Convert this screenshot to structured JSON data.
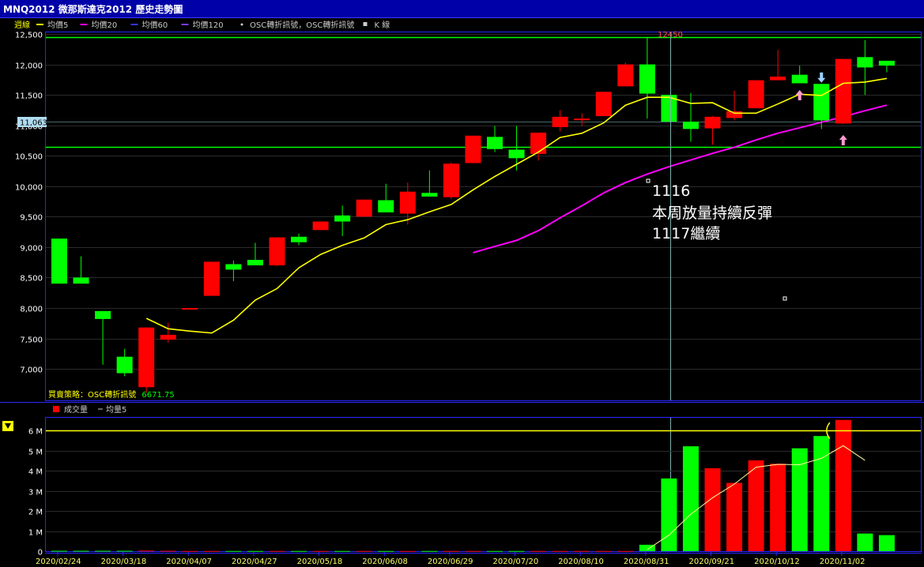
{
  "window_title": "MNQ2012 微那斯達克2012  歷史走勢圖",
  "colors": {
    "up": "#ff0000",
    "down": "#00ff00",
    "ma5": "#ffff00",
    "ma20": "#ff00ff",
    "ma60": "#3333ff",
    "ma120": "#7a3cff",
    "hline": "#00ff00",
    "vol_ref": "#ffff00",
    "frame": "#2828ff"
  },
  "legend": [
    {
      "label": "週線",
      "color": "#ffff00"
    },
    {
      "label": "均價5",
      "color": "#ffff00"
    },
    {
      "label": "均價20",
      "color": "#ff00ff"
    },
    {
      "label": "均價60",
      "color": "#3333ff"
    },
    {
      "label": "均價120",
      "color": "#7a3cff"
    },
    {
      "label": "OSC轉折訊號，OSC轉折訊號",
      "color": "#cccccc"
    },
    {
      "label": "K 線",
      "color": "#cccccc"
    }
  ],
  "vol_legend": {
    "vol_label": "成交量",
    "ma_label": "均量5"
  },
  "strategy_label": "買賣策略：OSC轉折訊號",
  "strategy_value": "6671.75",
  "cursor_value": "11,063",
  "high_marker": "12450",
  "annotation": [
    "1116",
    "本周放量持續反彈",
    "1117繼續"
  ],
  "chart_data": [
    {
      "type": "candlestick",
      "x_ticks": [
        "2020/02/24",
        "2020/03/18",
        "2020/04/07",
        "2020/04/27",
        "2020/05/18",
        "2020/06/08",
        "2020/06/29",
        "2020/07/20",
        "2020/08/10",
        "2020/08/31",
        "2020/09/21",
        "2020/10/12",
        "2020/11/02"
      ],
      "x_tick_index": [
        0,
        3,
        6,
        9,
        12,
        15,
        18,
        21,
        24,
        27,
        30,
        33,
        36
      ],
      "yticks": [
        "7,000",
        "7,500",
        "8,000",
        "8,500",
        "9,000",
        "9,500",
        "10,000",
        "10,500",
        "11,000",
        "11,500",
        "12,000",
        "12,500"
      ],
      "ylim": [
        6600,
        12500
      ],
      "candles": [
        {
          "o": 9140,
          "h": 9140,
          "l": 8400,
          "c": 8400
        },
        {
          "o": 8500,
          "h": 8850,
          "l": 8400,
          "c": 8400
        },
        {
          "o": 7950,
          "h": 7950,
          "l": 7070,
          "c": 7820
        },
        {
          "o": 7200,
          "h": 7330,
          "l": 6880,
          "c": 6930
        },
        {
          "o": 6700,
          "h": 7680,
          "l": 6610,
          "c": 7680
        },
        {
          "o": 7480,
          "h": 7760,
          "l": 7430,
          "c": 7560
        },
        {
          "o": 8000,
          "h": 8000,
          "l": 8000,
          "c": 8000
        },
        {
          "o": 8200,
          "h": 8760,
          "l": 8200,
          "c": 8760
        },
        {
          "o": 8720,
          "h": 8780,
          "l": 8440,
          "c": 8630
        },
        {
          "o": 8790,
          "h": 9070,
          "l": 8720,
          "c": 8700
        },
        {
          "o": 8700,
          "h": 9160,
          "l": 8690,
          "c": 9160
        },
        {
          "o": 9170,
          "h": 9220,
          "l": 9030,
          "c": 9080
        },
        {
          "o": 9280,
          "h": 9420,
          "l": 9280,
          "c": 9420
        },
        {
          "o": 9520,
          "h": 9680,
          "l": 9180,
          "c": 9420
        },
        {
          "o": 9500,
          "h": 9780,
          "l": 9500,
          "c": 9780
        },
        {
          "o": 9770,
          "h": 10040,
          "l": 9590,
          "c": 9570
        },
        {
          "o": 9550,
          "h": 10060,
          "l": 9370,
          "c": 9910
        },
        {
          "o": 9890,
          "h": 10260,
          "l": 9840,
          "c": 9830
        },
        {
          "o": 9820,
          "h": 10390,
          "l": 9790,
          "c": 10370
        },
        {
          "o": 10380,
          "h": 10830,
          "l": 10380,
          "c": 10830
        },
        {
          "o": 10810,
          "h": 10990,
          "l": 10560,
          "c": 10610
        },
        {
          "o": 10600,
          "h": 10990,
          "l": 10260,
          "c": 10460
        },
        {
          "o": 10530,
          "h": 10880,
          "l": 10420,
          "c": 10880
        },
        {
          "o": 10970,
          "h": 11250,
          "l": 10900,
          "c": 11140
        },
        {
          "o": 11110,
          "h": 11200,
          "l": 10990,
          "c": 11110
        },
        {
          "o": 11150,
          "h": 11550,
          "l": 11150,
          "c": 11550
        },
        {
          "o": 11640,
          "h": 12030,
          "l": 11640,
          "c": 12000
        },
        {
          "o": 12000,
          "h": 12450,
          "l": 11110,
          "c": 11520
        },
        {
          "o": 11500,
          "h": 11500,
          "l": 11060,
          "c": 11060
        },
        {
          "o": 11060,
          "h": 11530,
          "l": 10730,
          "c": 10940
        },
        {
          "o": 10950,
          "h": 11150,
          "l": 10680,
          "c": 11140
        },
        {
          "o": 11120,
          "h": 11570,
          "l": 11080,
          "c": 11230
        },
        {
          "o": 11280,
          "h": 11740,
          "l": 11280,
          "c": 11740
        },
        {
          "o": 11740,
          "h": 12240,
          "l": 11740,
          "c": 11800
        },
        {
          "o": 11830,
          "h": 11980,
          "l": 11690,
          "c": 11690
        },
        {
          "o": 11680,
          "h": 11680,
          "l": 10940,
          "c": 11080
        },
        {
          "o": 11030,
          "h": 12090,
          "l": 11020,
          "c": 12090
        },
        {
          "o": 12120,
          "h": 12400,
          "l": 11500,
          "c": 11950
        },
        {
          "o": 12060,
          "h": 12060,
          "l": 11870,
          "c": 11980
        }
      ],
      "ma5": [
        null,
        null,
        null,
        null,
        7830,
        7660,
        7620,
        7590,
        7800,
        8130,
        8320,
        8660,
        8880,
        9030,
        9150,
        9370,
        9450,
        9580,
        9700,
        9940,
        10160,
        10360,
        10560,
        10800,
        10870,
        11040,
        11330,
        11460,
        11460,
        11360,
        11370,
        11200,
        11200,
        11350,
        11510,
        11490,
        11690,
        11710,
        11770
      ],
      "ma20": [
        null,
        null,
        null,
        null,
        null,
        null,
        null,
        null,
        null,
        null,
        null,
        null,
        null,
        null,
        null,
        null,
        null,
        null,
        null,
        8910,
        9010,
        9110,
        9270,
        9480,
        9680,
        9890,
        10060,
        10200,
        10320,
        10430,
        10540,
        10640,
        10760,
        10870,
        10960,
        11050,
        11140,
        11240,
        11330
      ],
      "hlines": [
        12450,
        10650
      ]
    },
    {
      "type": "bar",
      "ylabel_unit": "M",
      "yticks": [
        "0",
        "1 M",
        "2 M",
        "3 M",
        "4 M",
        "5 M",
        "6 M"
      ],
      "ylim": [
        0,
        6.6
      ],
      "volume": [
        0.02,
        0.02,
        0.02,
        0.02,
        0.03,
        0.02,
        0.01,
        0.01,
        0.01,
        0.01,
        0.01,
        0.01,
        0.01,
        0.01,
        0.01,
        0.01,
        0.01,
        0.01,
        0.01,
        0.01,
        0.01,
        0.01,
        0.01,
        0.01,
        0.01,
        0.01,
        0.01,
        0.32,
        3.62,
        5.22,
        4.13,
        3.4,
        4.52,
        4.35,
        5.12,
        5.73,
        6.53,
        0.88,
        0.8
      ],
      "vol_ma5": [
        null,
        null,
        null,
        null,
        null,
        null,
        null,
        null,
        null,
        null,
        null,
        null,
        null,
        null,
        null,
        null,
        null,
        null,
        null,
        null,
        null,
        null,
        null,
        null,
        null,
        null,
        null,
        0.08,
        0.8,
        1.84,
        2.66,
        3.34,
        4.18,
        4.32,
        4.3,
        4.62,
        5.25,
        4.52,
        null
      ],
      "ref_line": 6.0
    }
  ]
}
